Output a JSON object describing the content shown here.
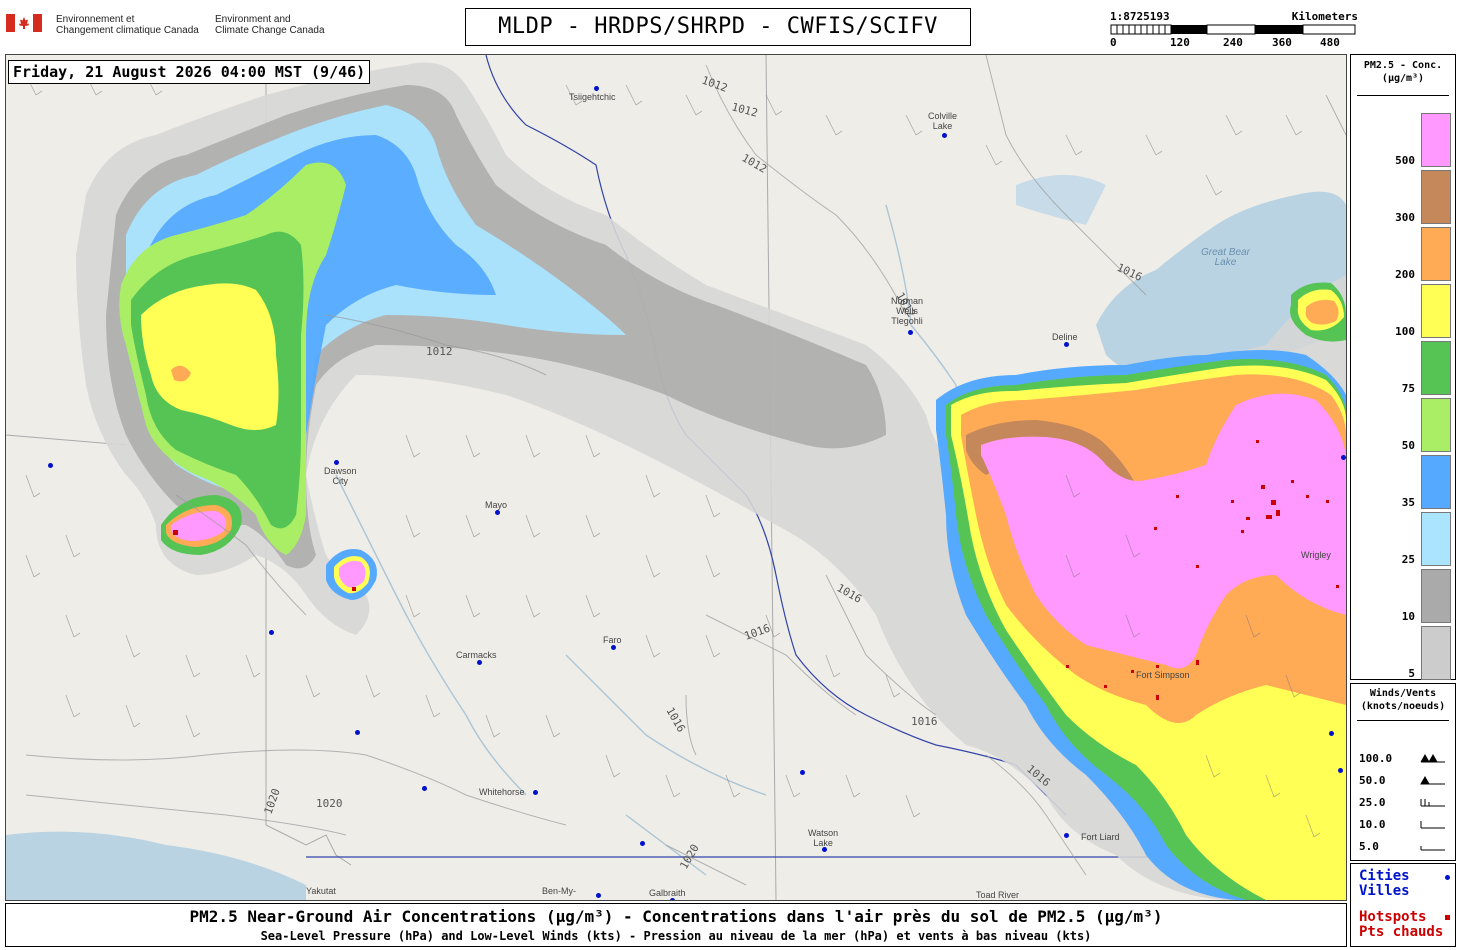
{
  "header": {
    "org_fr_1": "Environnement et",
    "org_fr_2": "Changement climatique Canada",
    "org_en_1": "Environment and",
    "org_en_2": "Climate Change Canada",
    "title": "MLDP - HRDPS/SHRPD - CWFIS/SCIFV"
  },
  "scale": {
    "ratio": "1:8725193",
    "unit": "Kilometers",
    "ticks": [
      "0",
      "120",
      "240",
      "360",
      "480"
    ]
  },
  "timestamp": "Friday, 21 August 2026 04:00 MST (9/46)",
  "cities": [
    {
      "name": "Tsiigehtchic"
    },
    {
      "name": "Colville\nLake"
    },
    {
      "name": "Norman\nWells\nTlegohli"
    },
    {
      "name": "Deline"
    },
    {
      "name": "Dawson\nCity"
    },
    {
      "name": "Mayo"
    },
    {
      "name": "Carmacks"
    },
    {
      "name": "Faro"
    },
    {
      "name": "Whitehorse"
    },
    {
      "name": "Watson\nLake"
    },
    {
      "name": "Yakutat"
    },
    {
      "name": "Ben-My-"
    },
    {
      "name": "Galbraith"
    },
    {
      "name": "Toad River"
    },
    {
      "name": "Fort Simpson"
    },
    {
      "name": "Wrigley"
    },
    {
      "name": "Fort Liard"
    }
  ],
  "water_labels": [
    "Great Bear\nLake"
  ],
  "isobars": [
    "1012",
    "1012",
    "1012",
    "1012",
    "1012",
    "1016",
    "1016",
    "1016",
    "1016",
    "1016",
    "1016",
    "1020",
    "1020",
    "1020"
  ],
  "legend": {
    "title": "PM2.5 - Conc.\n(µg/m³)",
    "levels": [
      {
        "label": "500",
        "color": "#ff99ff"
      },
      {
        "label": "300",
        "color": "#c4885a"
      },
      {
        "label": "200",
        "color": "#ffaa55"
      },
      {
        "label": "100",
        "color": "#ffff55"
      },
      {
        "label": "75",
        "color": "#55c455"
      },
      {
        "label": "50",
        "color": "#aaee66"
      },
      {
        "label": "35",
        "color": "#55aaff"
      },
      {
        "label": "25",
        "color": "#aae4ff"
      },
      {
        "label": "10",
        "color": "#aaaaaa"
      },
      {
        "label": "5",
        "color": "#cccccc"
      }
    ]
  },
  "winds": {
    "title": "Winds/Vents\n(knots/noeuds)",
    "levels": [
      "100.0",
      "50.0",
      "25.0",
      "10.0",
      "5.0"
    ]
  },
  "city_legend": {
    "en": "Cities",
    "fr": "Villes",
    "color": "#0011cc"
  },
  "hotspot_legend": {
    "en": "Hotspots",
    "fr": "Pts chauds",
    "color": "#cc0000"
  },
  "footer": {
    "line1": "PM2.5 Near-Ground Air Concentrations (µg/m³) - Concentrations dans l'air près du sol de PM2.5 (µg/m³)",
    "line2": "Sea-Level Pressure (hPa) and Low-Level Winds (kts) - Pression au niveau de la mer (hPa) et vents à bas niveau (kts)"
  }
}
